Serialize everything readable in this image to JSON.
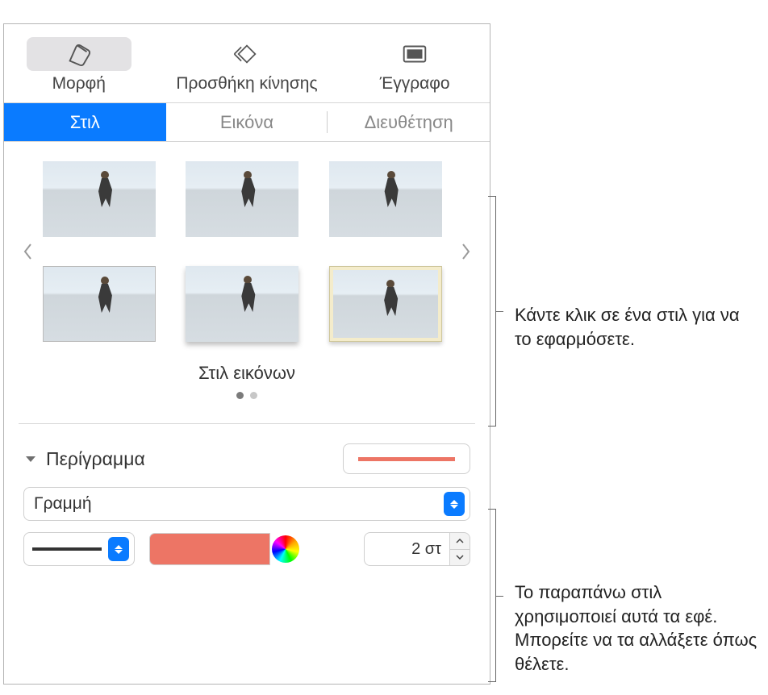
{
  "toolbar": {
    "format": "Μορφή",
    "animate": "Προσθήκη κίνησης",
    "document": "Έγγραφο"
  },
  "subtabs": {
    "style": "Στιλ",
    "image": "Εικόνα",
    "arrange": "Διευθέτηση"
  },
  "stylePicker": {
    "title": "Στιλ εικόνων"
  },
  "border": {
    "title": "Περίγραμμα",
    "type": "Γραμμή",
    "widthValue": "2 στ",
    "colorHex": "#ed7565"
  },
  "callouts": {
    "styleTip": "Κάντε κλικ σε ένα στιλ για να το εφαρμόσετε.",
    "effectsTip": "Το παραπάνω στιλ χρησιμοποιεί αυτά τα εφέ. Μπορείτε να τα αλλάξετε όπως θέλετε."
  }
}
